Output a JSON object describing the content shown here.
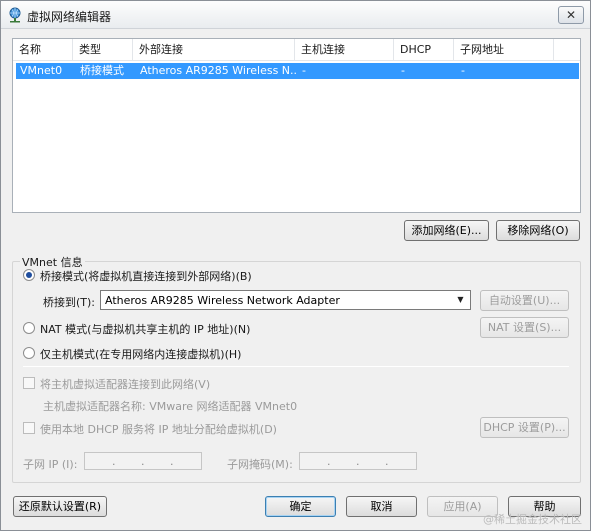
{
  "window": {
    "title": "虚拟网络编辑器",
    "close_glyph": "✕"
  },
  "network_table": {
    "columns": [
      "名称",
      "类型",
      "外部连接",
      "主机连接",
      "DHCP",
      "子网地址"
    ],
    "rows": [
      {
        "name": "VMnet0",
        "type": "桥接模式",
        "external": "Atheros AR9285 Wireless N...",
        "host": "-",
        "dhcp": "-",
        "subnet": "-"
      }
    ]
  },
  "buttons": {
    "add_network": "添加网络(E)...",
    "remove_network": "移除网络(O)",
    "auto_settings": "自动设置(U)...",
    "nat_settings": "NAT 设置(S)...",
    "dhcp_settings": "DHCP 设置(P)...",
    "restore_defaults": "还原默认设置(R)",
    "ok": "确定",
    "cancel": "取消",
    "apply": "应用(A)",
    "help": "帮助"
  },
  "vmnet_info": {
    "group_label": "VMnet 信息",
    "bridge_mode": "桥接模式(将虚拟机直接连接到外部网络)(B)",
    "bridge_to_label": "桥接到(T):",
    "bridge_to_value": "Atheros AR9285 Wireless Network Adapter",
    "nat_mode": "NAT 模式(与虚拟机共享主机的 IP 地址)(N)",
    "host_only_mode": "仅主机模式(在专用网络内连接虚拟机)(H)",
    "connect_host_adapter": "将主机虚拟适配器连接到此网络(V)",
    "host_adapter_name": "主机虚拟适配器名称: VMware 网络适配器 VMnet0",
    "use_dhcp": "使用本地 DHCP 服务将 IP 地址分配给虚拟机(D)",
    "subnet_ip_label": "子网 IP (I):",
    "subnet_mask_label": "子网掩码(M):",
    "ip_dot": "."
  },
  "watermark": "@稀土掘金技术社区"
}
